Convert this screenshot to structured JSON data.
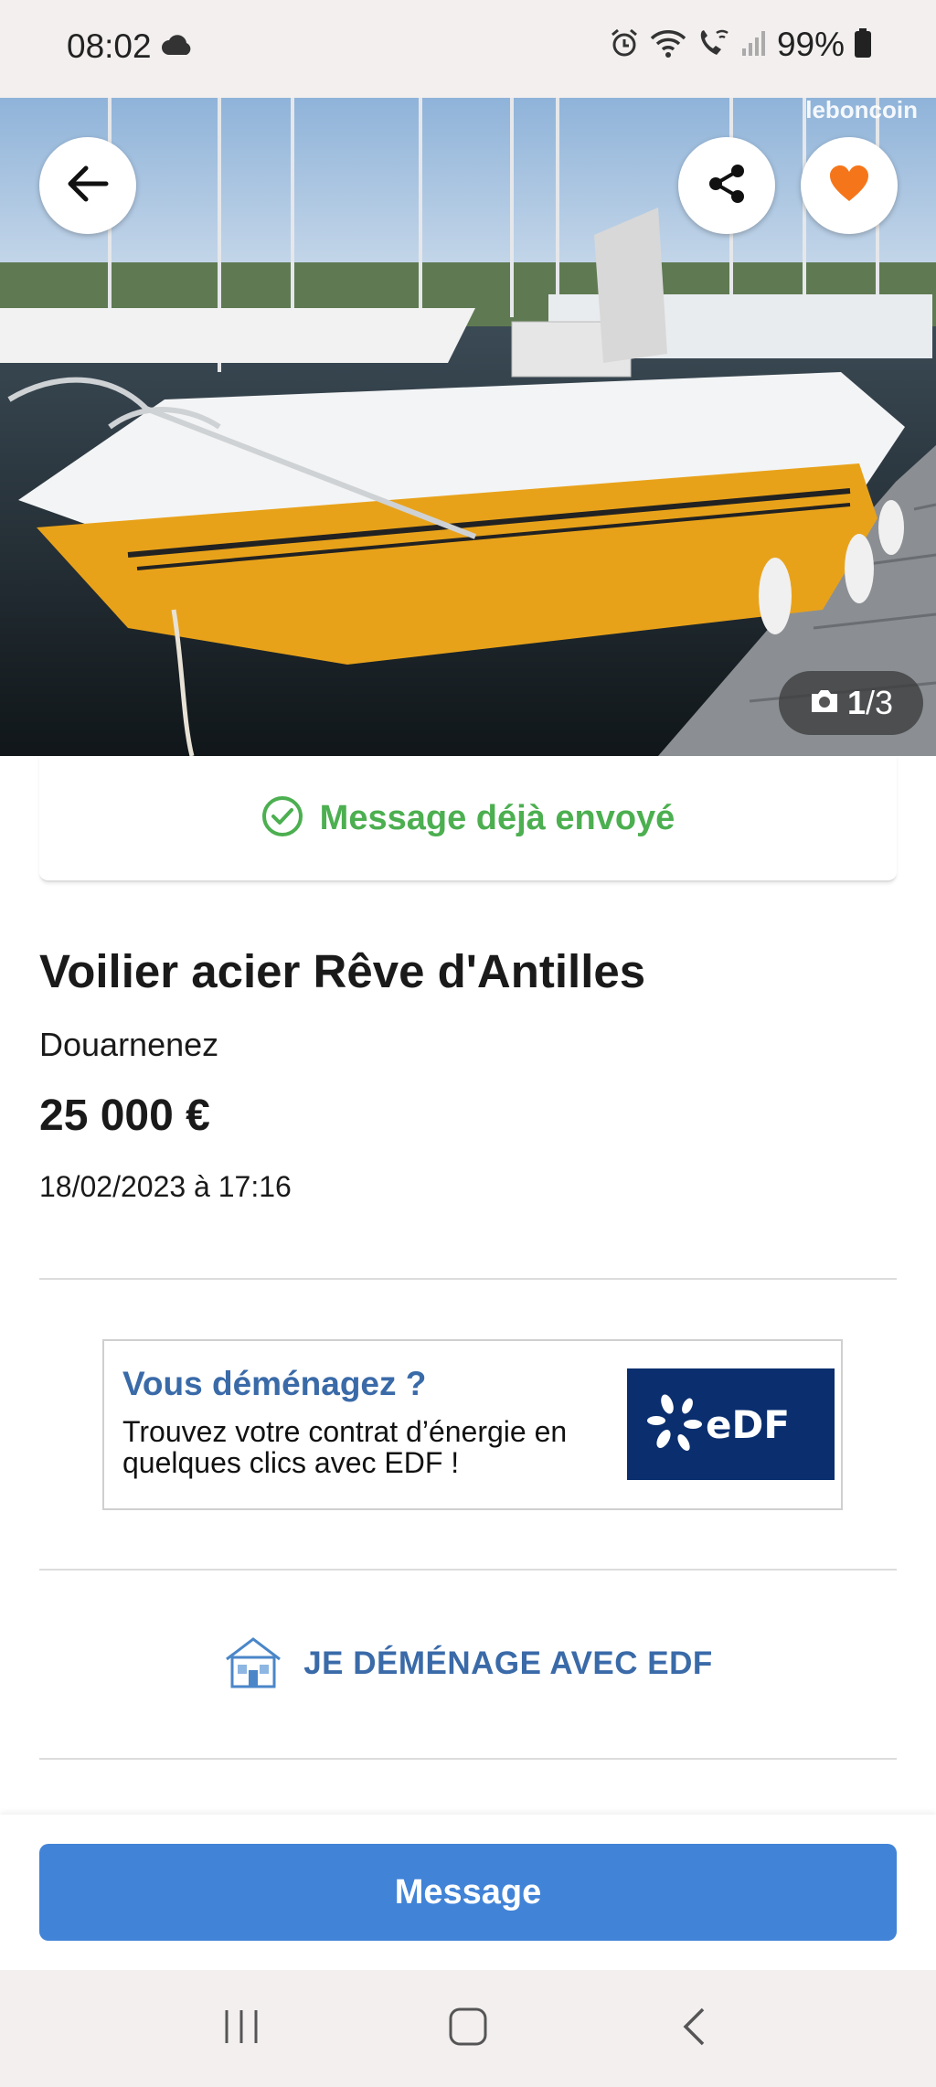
{
  "status_bar": {
    "time": "08:02",
    "battery": "99%",
    "icons": [
      "cloud-icon",
      "alarm-icon",
      "wifi-icon",
      "wifi-call-icon",
      "signal-icon",
      "battery-icon"
    ]
  },
  "hero": {
    "watermark": "leboncoin",
    "photo_index": "1",
    "photo_total": "/3",
    "accent": "#f5761a"
  },
  "banner": {
    "sent_label": "Message déjà envoyé",
    "color": "#4caf50"
  },
  "listing": {
    "title": "Voilier acier Rêve d'Antilles",
    "location": "Douarnenez",
    "price": "25 000 €",
    "date": "18/02/2023 à 17:16"
  },
  "ad": {
    "title": "Vous déménagez ?",
    "body": "Trouvez votre contrat d’énergie en quelques clics avec EDF !",
    "logo_text": "eDF",
    "cta_label": "JE DÉMÉNAGE AVEC EDF"
  },
  "actions": {
    "message_label": "Message",
    "color": "#4183d7"
  }
}
